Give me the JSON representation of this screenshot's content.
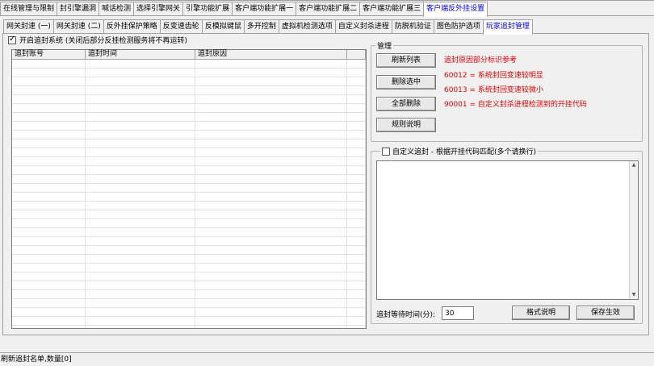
{
  "top_tabs": [
    {
      "label": "在线管理与限制",
      "active": false
    },
    {
      "label": "封引擎漏洞",
      "active": false
    },
    {
      "label": "喊话检测",
      "active": false
    },
    {
      "label": "选择引擎网关",
      "active": false
    },
    {
      "label": "引擎功能扩展",
      "active": false
    },
    {
      "label": "客户端功能扩展一",
      "active": false
    },
    {
      "label": "客户端功能扩展二",
      "active": false
    },
    {
      "label": "客户端功能扩展三",
      "active": false
    },
    {
      "label": "客户端反外挂设置",
      "active": true
    }
  ],
  "sub_tabs": [
    {
      "label": "网关封速 (一)",
      "active": false
    },
    {
      "label": "网关封速 (二)",
      "active": false
    },
    {
      "label": "反外挂保护策略",
      "active": false
    },
    {
      "label": "反变速齿轮",
      "active": false
    },
    {
      "label": "反模拟键鼠",
      "active": false
    },
    {
      "label": "多开控制",
      "active": false
    },
    {
      "label": "虚拟机检测选项",
      "active": false
    },
    {
      "label": "自定义封杀进程",
      "active": false
    },
    {
      "label": "防脱机验证",
      "active": false
    },
    {
      "label": "图色防护选项",
      "active": false
    },
    {
      "label": "玩家追封管理",
      "active": true
    }
  ],
  "enable": {
    "checked": true,
    "label": "开启追封系统 (关闭后部分反挂检测服务将不再运转)"
  },
  "list": {
    "columns": [
      "追封账号",
      "追封时间",
      "追封原因"
    ],
    "rows": []
  },
  "manage": {
    "title": "管理",
    "buttons": {
      "refresh": "刷新列表",
      "delete_selected": "删除选中",
      "delete_all": "全部删除",
      "rules": "规则说明"
    },
    "notes": {
      "heading": "追封原因部分标识参考",
      "code1": "60012  = 系统封回变速较明显",
      "code2": "60013  = 系统封回变速较微小",
      "code3": "90001  = 自定义封杀进程检测到的开挂代码"
    }
  },
  "custom": {
    "checked": false,
    "title": "自定义追封 - 根据开挂代码匹配(多个请换行)",
    "codes_text": "",
    "wait_label": "追封等待时间(分):",
    "wait_value": "30",
    "format_button": "格式说明",
    "save_button": "保存生效"
  },
  "status": "刷新追封名单,数量[0]"
}
